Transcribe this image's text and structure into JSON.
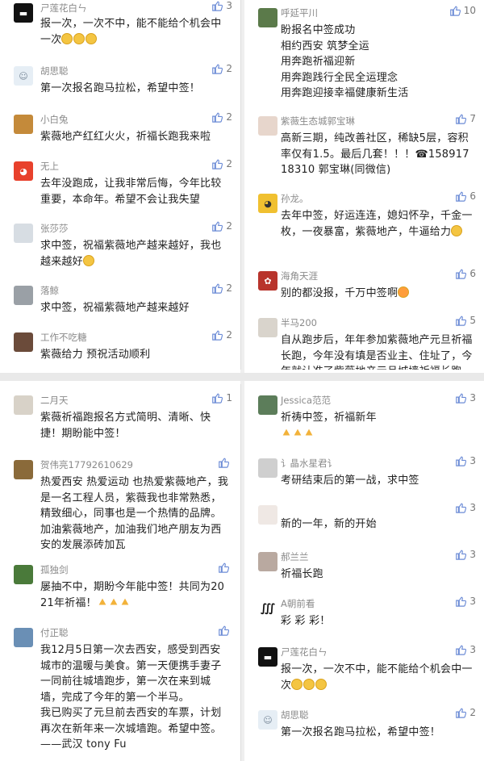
{
  "panels": [
    {
      "comments": [
        {
          "user": "ㄕ莲花白ㄣ",
          "likes": "3",
          "text": "报一次，一次不中，能不能给个机会中一次",
          "emoji": [
            "😁",
            "😁",
            "😁"
          ]
        },
        {
          "user": "胡思聪",
          "likes": "2",
          "text": "第一次报名跑马拉松，希望中签！"
        },
        {
          "user": "小白兔",
          "likes": "2",
          "text": "紫薇地产红红火火，祈福长跑我来啦"
        },
        {
          "user": "无上",
          "likes": "2",
          "text": "去年没跑成，让我非常后悔，今年比较重要，本命年。希望不会让我失望"
        },
        {
          "user": "张莎莎",
          "likes": "2",
          "text": "求中签，祝福紫薇地产越来越好，我也越来越好"
        },
        {
          "user": "落鲸",
          "likes": "2",
          "text": "求中签，祝福紫薇地产越来越好"
        },
        {
          "user": "工作不吃糖",
          "likes": "2",
          "text": "紫薇给力 预祝活动顺利"
        }
      ]
    },
    {
      "comments": [
        {
          "user": "呼延平川",
          "likes": "10",
          "text": "盼报名中签成功\n相约西安 筑梦全运\n用奔跑祈福迎新\n用奔跑践行全民全运理念\n用奔跑迎接幸福健康新生活"
        },
        {
          "user": "紫薇生态城郭宝琳",
          "likes": "7",
          "text": "高新三期，纯改善社区，稀缺5层，容积率仅有1.5。最后几套！！！☎15891718310 郭宝琳(同微信)"
        },
        {
          "user": "孙龙。",
          "likes": "6",
          "text": "去年中签，好运连连，媳妇怀孕，千金一枚，一夜暴富，紫薇地产，牛逼给力"
        },
        {
          "user": "海角天涯",
          "likes": "6",
          "text": "别的都没报，千万中签啊"
        },
        {
          "user": "半马200",
          "likes": "5",
          "text": "自从跑步后，年年参加紫薇地产元旦祈福长跑，今年没有填是否业主、住址了，今年就认准了紫薇地产元旦城墙祈福长跑，别的赛事都不报名，希望能够中签紫薇地"
        }
      ]
    },
    {
      "comments": [
        {
          "user": "二月天",
          "likes": "1",
          "text": "紫薇祈福跑报名方式简明、清晰、快捷！期盼能中签！"
        },
        {
          "user": "贺伟亮17792610629",
          "likes": "",
          "text": "热爱西安 热爱运动 也热爱紫薇地产，我是一名工程人员，紫薇我也非常熟悉，精致细心，同事也是一个热情的品牌。加油紫薇地产，加油我们地产朋友为西安的发展添砖加瓦"
        },
        {
          "user": "孤独剑",
          "likes": "",
          "text": "屡抽不中，期盼今年能中签！共同为2021年祈福！"
        },
        {
          "user": "付正聪",
          "likes": "",
          "text": "我12月5日第一次去西安，感受到西安城市的温暖与美食。第一天便携手妻子一同前往城墙跑步，第一次在来到城墙，完成了今年的第一个半马。\n我已购买了元旦前去西安的车票，计划再次在新年来一次城墙跑。希望中签。\n——武汉 tony Fu"
        }
      ]
    },
    {
      "comments": [
        {
          "user": "Jessica范范",
          "likes": "3",
          "text": "祈祷中签，祈福新年"
        },
        {
          "user": "讠晶水星君讠",
          "likes": "3",
          "text": "考研结束后的第一战，求中签"
        },
        {
          "user": "",
          "likes": "3",
          "text": "新的一年，新的开始"
        },
        {
          "user": "郝兰兰",
          "likes": "3",
          "text": "祈福长跑"
        },
        {
          "user": "A朝前看",
          "likes": "3",
          "text": "彩 彩 彩！"
        },
        {
          "user": "ㄕ莲花白ㄣ",
          "likes": "3",
          "text": "报一次，一次不中，能不能给个机会中一次"
        },
        {
          "user": "胡思聪",
          "likes": "2",
          "text": "第一次报名跑马拉松，希望中签！"
        }
      ]
    }
  ],
  "colors": {
    "username": "#8a8a8a",
    "text": "#222222",
    "divider": "#e9e9e9"
  },
  "icons": {
    "like": "thumbs-up-icon"
  }
}
